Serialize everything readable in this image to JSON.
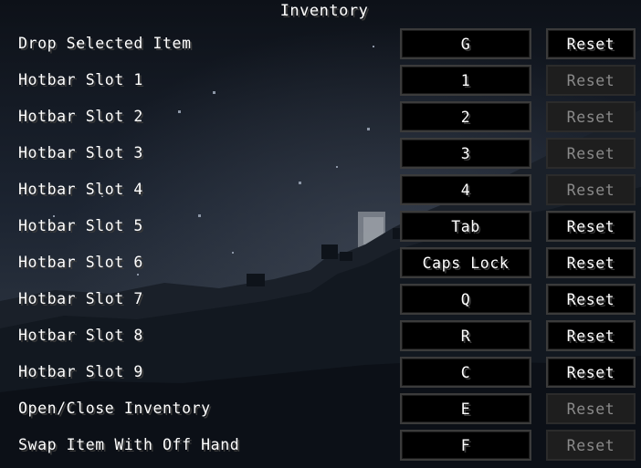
{
  "screen": {
    "section_title": "Inventory"
  },
  "keybinds": [
    {
      "action": "Drop Selected Item",
      "key": "G",
      "reset_label": "Reset",
      "reset_enabled": true
    },
    {
      "action": "Hotbar Slot 1",
      "key": "1",
      "reset_label": "Reset",
      "reset_enabled": false
    },
    {
      "action": "Hotbar Slot 2",
      "key": "2",
      "reset_label": "Reset",
      "reset_enabled": false
    },
    {
      "action": "Hotbar Slot 3",
      "key": "3",
      "reset_label": "Reset",
      "reset_enabled": false
    },
    {
      "action": "Hotbar Slot 4",
      "key": "4",
      "reset_label": "Reset",
      "reset_enabled": false
    },
    {
      "action": "Hotbar Slot 5",
      "key": "Tab",
      "reset_label": "Reset",
      "reset_enabled": true
    },
    {
      "action": "Hotbar Slot 6",
      "key": "Caps Lock",
      "reset_label": "Reset",
      "reset_enabled": true
    },
    {
      "action": "Hotbar Slot 7",
      "key": "Q",
      "reset_label": "Reset",
      "reset_enabled": true
    },
    {
      "action": "Hotbar Slot 8",
      "key": "R",
      "reset_label": "Reset",
      "reset_enabled": true
    },
    {
      "action": "Hotbar Slot 9",
      "key": "C",
      "reset_label": "Reset",
      "reset_enabled": true
    },
    {
      "action": "Open/Close Inventory",
      "key": "E",
      "reset_label": "Reset",
      "reset_enabled": false
    },
    {
      "action": "Swap Item With Off Hand",
      "key": "F",
      "reset_label": "Reset",
      "reset_enabled": false
    }
  ],
  "colors": {
    "text": "#ffffff",
    "disabled_text": "#8a8a8a",
    "button_bg": "#000000",
    "button_border": "#3b3b3b"
  }
}
